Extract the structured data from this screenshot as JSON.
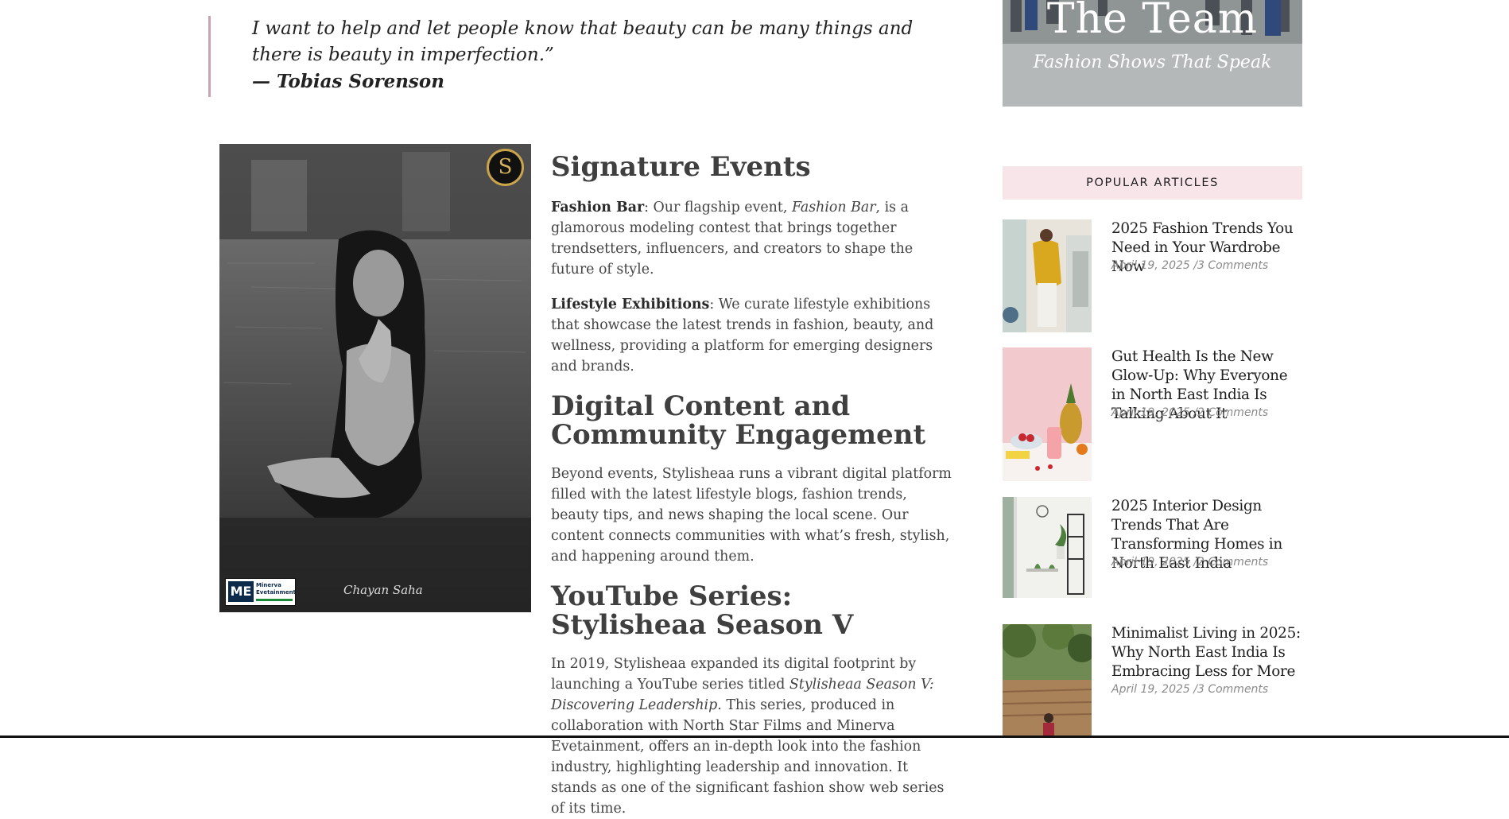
{
  "quote": {
    "text": "I want to help and let people know that beauty can be many things and there is beauty in imperfection.”",
    "author": "— Tobias Sorenson"
  },
  "event_photo": {
    "credit": "Chayan Saha",
    "logo_mark": "ME",
    "logo_name_1": "Minerva",
    "logo_name_2": "Evetainment",
    "badge": "S"
  },
  "article": {
    "heading_signature": "Signature Events",
    "fashion_bar_label": "Fashion Bar",
    "fashion_bar_lead": ": Our flagship event, ",
    "fashion_bar_italic": "Fashion Bar",
    "fashion_bar_rest": ", is a glamorous modeling contest that brings together trendsetters, influencers, and creators to shape the future of style.",
    "lifestyle_label": "Lifestyle Exhibitions",
    "lifestyle_rest": ": We curate lifestyle exhibitions that showcase the latest trends in fashion, beauty, and wellness, providing a platform for emerging designers and brands.",
    "heading_digital": "Digital Content and Community Engagement",
    "digital_text": "Beyond events, Stylisheaa runs a vibrant digital platform filled with the latest lifestyle blogs, fashion trends, beauty tips, and news shaping the local scene. Our content connects communities with what’s fresh, stylish, and happening around them.",
    "heading_youtube": "YouTube Series: Stylisheaa Season V",
    "youtube_lead": "In 2019, Stylisheaa expanded its digital footprint by launching a YouTube series titled ",
    "youtube_italic": "Stylisheaa Season V: Discovering Leadership",
    "youtube_rest": ". This series, produced in collaboration with North Star Films and Minerva Evetainment, offers an in-depth look into the fashion industry, highlighting leadership and innovation. It stands as one of the significant fashion show web series of its time."
  },
  "sidebar": {
    "banner_title": "The Team",
    "banner_subtitle": "Fashion Shows That Speak",
    "popular_heading": "POPULAR ARTICLES",
    "articles": [
      {
        "title": "2025 Fashion Trends You Need in Your Wardrobe Now",
        "date": "April 19, 2025",
        "comments": "/3 Comments"
      },
      {
        "title": "Gut Health Is the New Glow-Up: Why Everyone in North East India Is Talking About It",
        "date": "April 19, 2025",
        "comments": "/2 Comments"
      },
      {
        "title": "2025 Interior Design Trends That Are Transforming Homes in North East India",
        "date": "April 19, 2025",
        "comments": "/2 Comments"
      },
      {
        "title": "Minimalist Living in 2025: Why North East India Is Embracing Less for More",
        "date": "April 19, 2025",
        "comments": "/3 Comments"
      }
    ]
  }
}
